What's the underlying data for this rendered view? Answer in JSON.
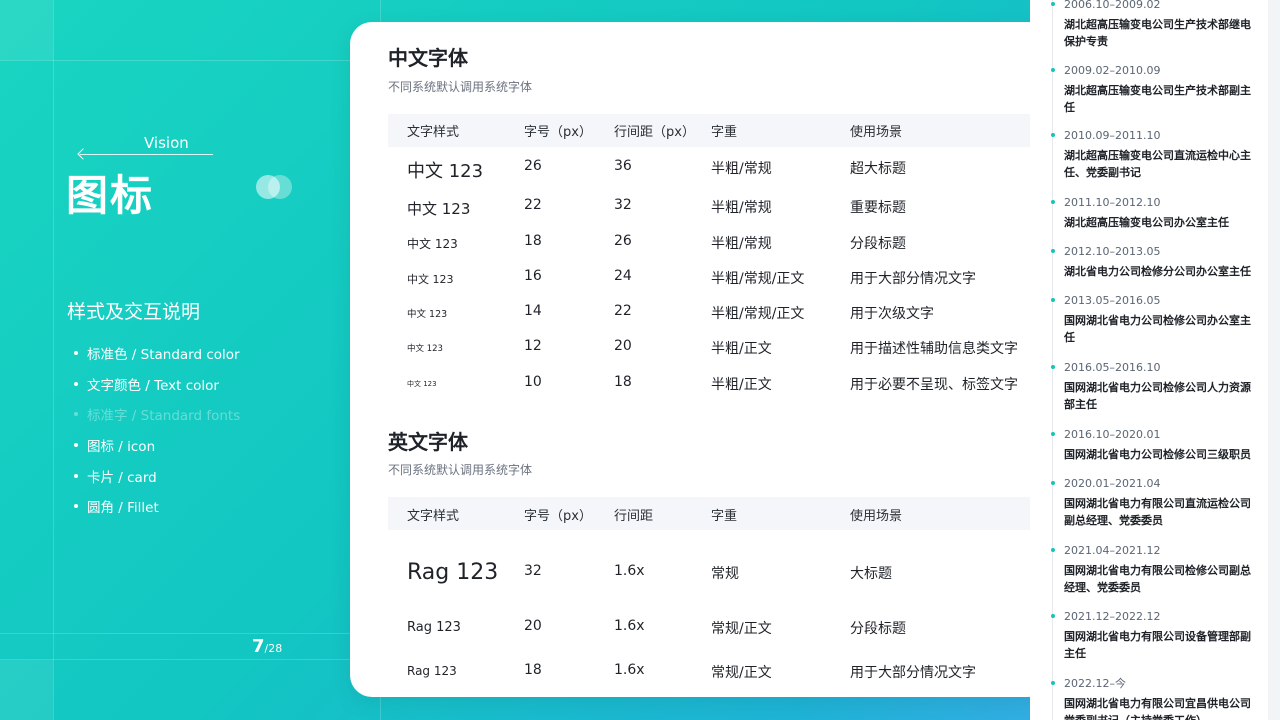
{
  "left": {
    "vision": "Vision",
    "title": "图标",
    "section_title": "样式及交互说明",
    "menu": [
      {
        "label": "标准色 / Standard color",
        "dim": false
      },
      {
        "label": "文字颜色 / Text color",
        "dim": false
      },
      {
        "label": "标准字 / Standard fonts",
        "dim": true
      },
      {
        "label": "图标 / icon",
        "dim": false
      },
      {
        "label": "卡片 / card",
        "dim": false
      },
      {
        "label": "圆角 / Fillet",
        "dim": false
      }
    ],
    "page_current": "7",
    "page_total": "/28"
  },
  "card": {
    "cn": {
      "title": "中文字体",
      "subtitle": "不同系统默认调用系统字体",
      "headers": [
        "文字样式",
        "字号（px）",
        "行间距（px）",
        "字重",
        "使用场景"
      ],
      "rows": [
        {
          "sample": "中文 123",
          "size": "26",
          "line": "36",
          "weight": "半粗/常规",
          "usage": "超大标题",
          "fs": 18
        },
        {
          "sample": "中文 123",
          "size": "22",
          "line": "32",
          "weight": "半粗/常规",
          "usage": "重要标题",
          "fs": 15
        },
        {
          "sample": "中文 123",
          "size": "18",
          "line": "26",
          "weight": "半粗/常规",
          "usage": "分段标题",
          "fs": 12
        },
        {
          "sample": "中文 123",
          "size": "16",
          "line": "24",
          "weight": "半粗/常规/正文",
          "usage": "用于大部分情况文字",
          "fs": 11
        },
        {
          "sample": "中文 123",
          "size": "14",
          "line": "22",
          "weight": "半粗/常规/正文",
          "usage": "用于次级文字",
          "fs": 9.5
        },
        {
          "sample": "中文 123",
          "size": "12",
          "line": "20",
          "weight": "半粗/正文",
          "usage": "用于描述性辅助信息类文字",
          "fs": 8.5
        },
        {
          "sample": "中文 123",
          "size": "10",
          "line": "18",
          "weight": "半粗/正文",
          "usage": "用于必要不呈现、标签文字",
          "fs": 7
        }
      ]
    },
    "en": {
      "title": "英文字体",
      "subtitle": "不同系统默认调用系统字体",
      "headers": [
        "文字样式",
        "字号（px）",
        "行间距",
        "字重",
        "使用场景"
      ],
      "rows": [
        {
          "sample": "Rag 123",
          "size": "32",
          "line": "1.6x",
          "weight": "常规",
          "usage": "大标题",
          "fs": 22
        },
        {
          "sample": "Rag 123",
          "size": "20",
          "line": "1.6x",
          "weight": "常规/正文",
          "usage": "分段标题",
          "fs": 13
        },
        {
          "sample": "Rag 123",
          "size": "18",
          "line": "1.6x",
          "weight": "常规/正文",
          "usage": "用于大部分情况文字",
          "fs": 12
        }
      ]
    }
  },
  "timeline": [
    {
      "date": "2006.10–2009.02",
      "text": "湖北超高压输变电公司生产技术部继电保护专责"
    },
    {
      "date": "2009.02–2010.09",
      "text": "湖北超高压输变电公司生产技术部副主任"
    },
    {
      "date": "2010.09–2011.10",
      "text": "湖北超高压输变电公司直流运检中心主任、党委副书记"
    },
    {
      "date": "2011.10–2012.10",
      "text": "湖北超高压输变电公司办公室主任"
    },
    {
      "date": "2012.10–2013.05",
      "text": "湖北省电力公司检修分公司办公室主任"
    },
    {
      "date": "2013.05–2016.05",
      "text": "国网湖北省电力公司检修公司办公室主任"
    },
    {
      "date": "2016.05–2016.10",
      "text": "国网湖北省电力公司检修公司人力资源部主任"
    },
    {
      "date": "2016.10–2020.01",
      "text": "国网湖北省电力公司检修公司三级职员"
    },
    {
      "date": "2020.01–2021.04",
      "text": "国网湖北省电力有限公司直流运检公司副总经理、党委委员"
    },
    {
      "date": "2021.04–2021.12",
      "text": "国网湖北省电力有限公司检修公司副总经理、党委委员"
    },
    {
      "date": "2021.12–2022.12",
      "text": "国网湖北省电力有限公司设备管理部副主任"
    },
    {
      "date": "2022.12–今",
      "text": "国网湖北省电力有限公司宜昌供电公司党委副书记（主持党委工作）"
    }
  ]
}
